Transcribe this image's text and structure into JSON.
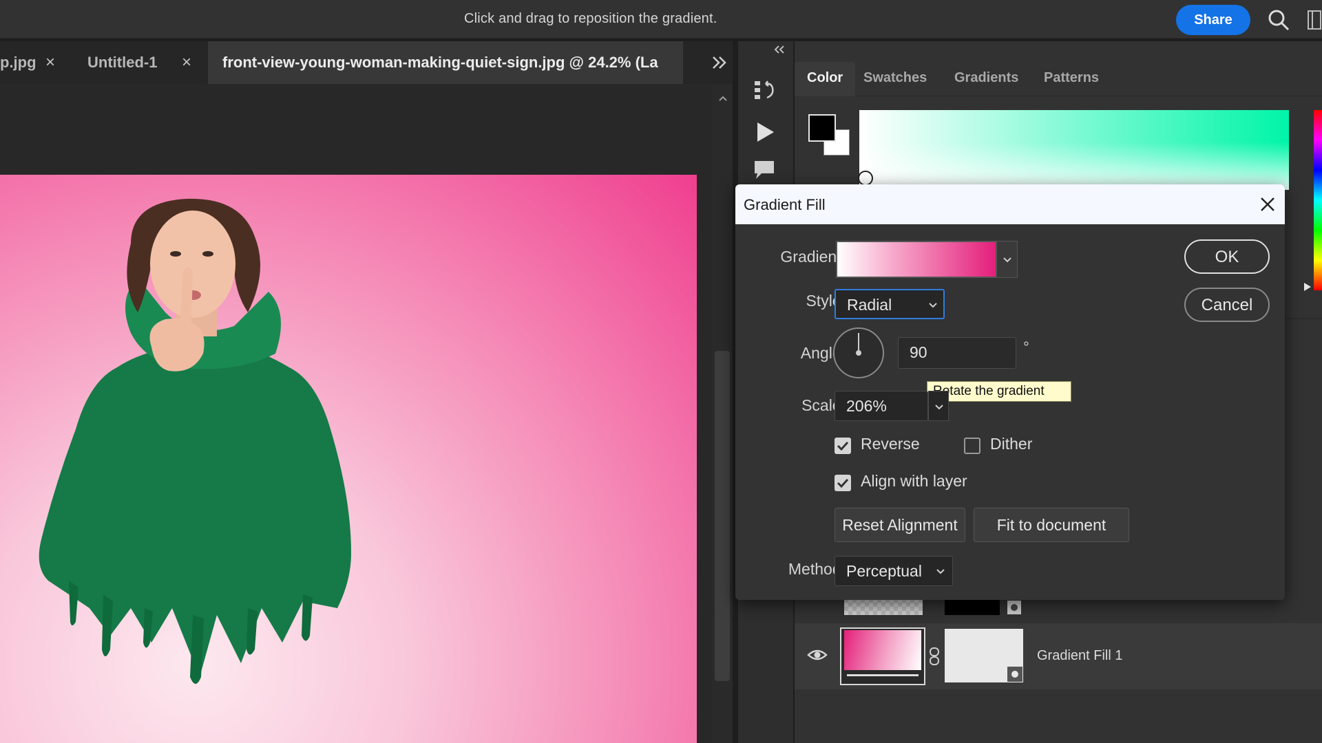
{
  "topbar": {
    "hint": "Click and drag to reposition the gradient.",
    "share_label": "Share",
    "accent_color": "#1473e6"
  },
  "doc_tabs": [
    {
      "label": "p.jpg",
      "close": "×"
    },
    {
      "label": "Untitled-1",
      "close": "×"
    },
    {
      "label": "front-view-young-woman-making-quiet-sign.jpg @ 24.2% (La",
      "active": true
    }
  ],
  "tab_overflow_icon": "double-chevron-right-icon",
  "color_panel": {
    "tabs": [
      "Color",
      "Swatches",
      "Gradients",
      "Patterns"
    ],
    "active_tab": "Color",
    "foreground_color": "#000000",
    "background_color": "#ffffff"
  },
  "dialog": {
    "title": "Gradient Fill",
    "gradient_label": "Gradient:",
    "gradient_colors": [
      "#ffffff",
      "#e41f7b"
    ],
    "style_label": "Style:",
    "style_value": "Radial",
    "angle_label": "Angle:",
    "angle_value": "90",
    "degree_symbol": "°",
    "tooltip": "Rotate the gradient",
    "scale_label": "Scale:",
    "scale_value": "206%",
    "reverse_label": "Reverse",
    "reverse_checked": true,
    "dither_label": "Dither",
    "dither_checked": false,
    "align_label": "Align with layer",
    "align_checked": true,
    "reset_alignment": "Reset Alignment",
    "fit_to_document": "Fit to document",
    "method_label": "Method:",
    "method_value": "Perceptual",
    "ok": "OK",
    "cancel": "Cancel"
  },
  "layers": [
    {
      "name": "",
      "visible": true
    },
    {
      "name": "Gradient Fill 1",
      "visible": true,
      "selected": true
    }
  ]
}
